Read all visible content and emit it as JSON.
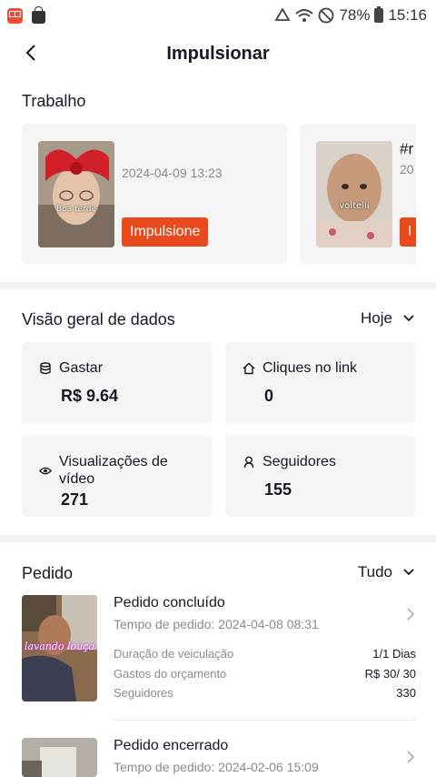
{
  "status_bar": {
    "battery": "78%",
    "time": "15:16"
  },
  "header": {
    "title": "Impulsionar"
  },
  "work": {
    "title": "Trabalho",
    "cards": [
      {
        "date": "2024-04-09 13:23",
        "button": "Impulsione",
        "thumb_caption": "Boa tarde"
      },
      {
        "title": "#r",
        "date": "20",
        "button": "I",
        "thumb_caption": "volteiii"
      }
    ]
  },
  "overview": {
    "title": "Visão geral de dados",
    "filter": "Hoje",
    "stats": [
      {
        "label": "Gastar",
        "value": "R$ 9.64",
        "icon": "database-icon"
      },
      {
        "label": "Cliques no link",
        "value": "0",
        "icon": "home-icon"
      },
      {
        "label": "Visualizações de vídeo",
        "value": "271",
        "icon": "eye-icon"
      },
      {
        "label": "Seguidores",
        "value": "155",
        "icon": "person-icon"
      }
    ]
  },
  "orders": {
    "title": "Pedido",
    "filter": "Tudo",
    "items": [
      {
        "status": "Pedido concluído",
        "time": "Tempo de pedido: 2024-04-08 08:31",
        "thumb_caption": "lavando louça",
        "rows": [
          {
            "label": "Duração de veiculação",
            "value": "1/1 Dias"
          },
          {
            "label": "Gastos do orçamento",
            "value": "R$ 30/ 30"
          },
          {
            "label": "Seguidores",
            "value": "330"
          }
        ]
      },
      {
        "status": "Pedido encerrado",
        "time": "Tempo de pedido: 2024-02-06 15:09"
      }
    ]
  }
}
